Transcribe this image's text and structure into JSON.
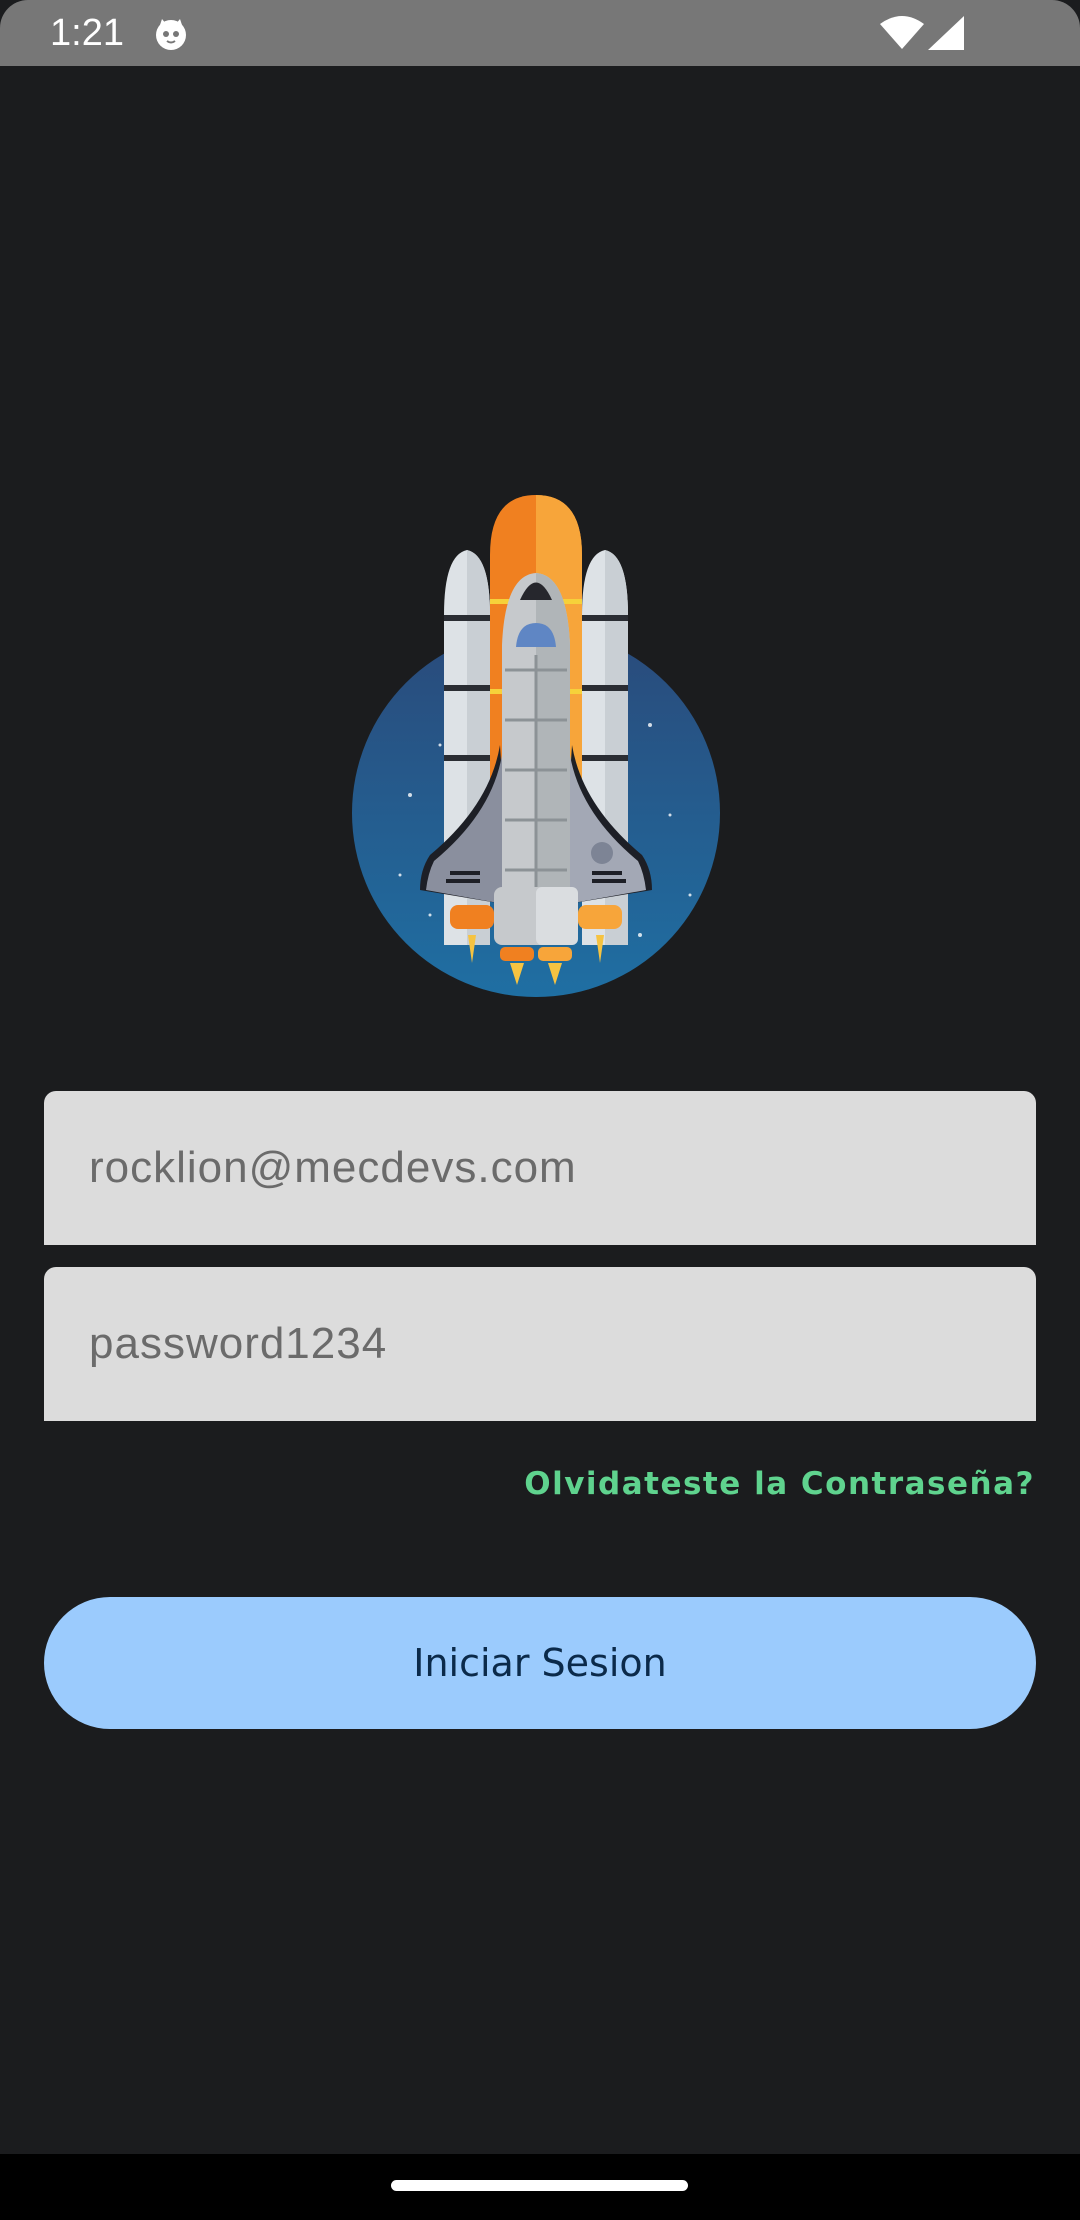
{
  "status_bar": {
    "time": "1:21",
    "icons": [
      "notification-cat-icon",
      "wifi-icon",
      "signal-icon"
    ]
  },
  "logo": {
    "icon": "space-shuttle-logo"
  },
  "login_form": {
    "email_value": "rocklion@mecdevs.com",
    "password_value": "password1234",
    "forgot_password_label": "Olvidateste la Contraseña?",
    "submit_label": "Iniciar Sesion"
  },
  "colors": {
    "background": "#1b1c1e",
    "field_background": "#dcdcdc",
    "accent_link": "#5fd38e",
    "button_background": "#9bcbfd",
    "button_text": "#0b2a4a"
  }
}
